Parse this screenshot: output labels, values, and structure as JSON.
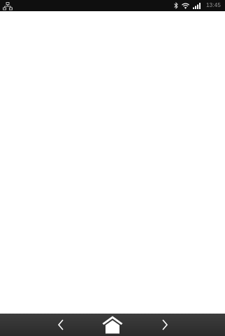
{
  "status_bar": {
    "left_icon": "network-tree-icon",
    "bluetooth_icon": "bluetooth-icon",
    "wifi_icon": "wifi-icon",
    "signal_icon": "cell-signal-icon",
    "time": "13:45",
    "background_color": "#0f0f0f",
    "time_color": "#9a9a9a"
  },
  "content": {
    "background_color": "#ffffff"
  },
  "nav_bar": {
    "back_icon": "chevron-left-icon",
    "home_icon": "home-icon",
    "forward_icon": "chevron-right-icon",
    "background_color": "#333333",
    "icon_color": "#ffffff"
  }
}
